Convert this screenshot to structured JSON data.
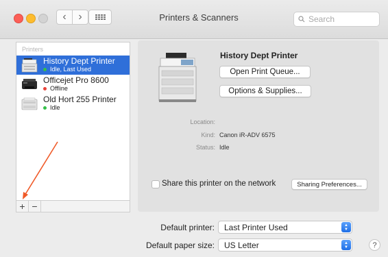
{
  "window": {
    "title": "Printers & Scanners",
    "search_placeholder": "Search"
  },
  "printer_list": {
    "header": "Printers",
    "items": [
      {
        "name": "History Dept Printer",
        "status": "Idle, Last Used",
        "status_color": "#35c04a",
        "selected": true
      },
      {
        "name": "Officejet Pro 8600",
        "status": "Offline",
        "status_color": "#e8433a",
        "selected": false
      },
      {
        "name": "Old Hort 255 Printer",
        "status": "Idle",
        "status_color": "#35c04a",
        "selected": false
      }
    ],
    "add_label": "+",
    "remove_label": "−"
  },
  "detail": {
    "printer_name": "History Dept Printer",
    "open_queue_label": "Open Print Queue...",
    "options_label": "Options & Supplies...",
    "location_label": "Location:",
    "location_value": "",
    "kind_label": "Kind:",
    "kind_value": "Canon iR-ADV 6575",
    "status_label": "Status:",
    "status_value": "Idle",
    "share_label": "Share this printer on the network",
    "share_checked": false,
    "sharing_prefs_label": "Sharing Preferences..."
  },
  "defaults": {
    "default_printer_label": "Default printer:",
    "default_printer_value": "Last Printer Used",
    "paper_size_label": "Default paper size:",
    "paper_size_value": "US Letter"
  },
  "help_label": "?",
  "colors": {
    "selection": "#2f6fd9",
    "annotation_arrow": "#f05a28"
  }
}
